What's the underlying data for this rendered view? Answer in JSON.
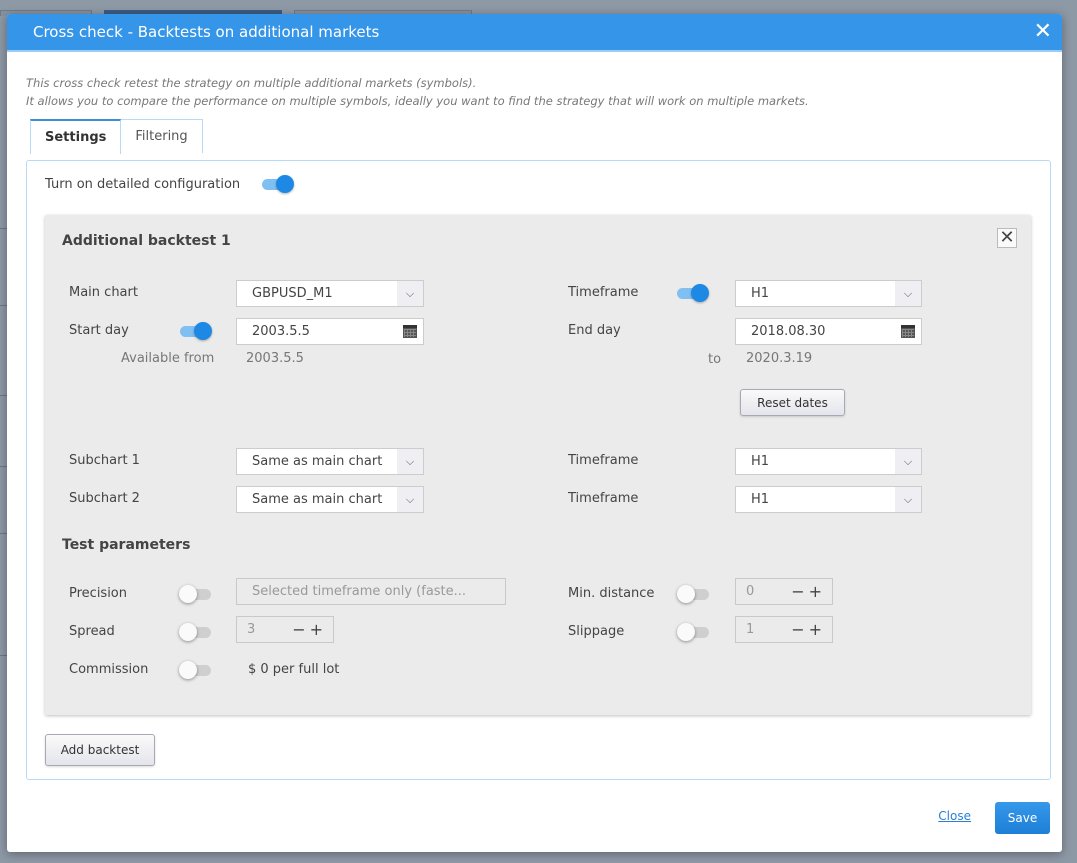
{
  "dialog": {
    "title": "Cross check - Backtests on additional markets",
    "close_icon": "close-icon",
    "description_line1": "This cross check retest the strategy on multiple additional markets (symbols).",
    "description_line2": "It allows you to compare the performance on multiple symbols, ideally you want to find the strategy that will work on multiple markets."
  },
  "tabs": [
    {
      "label": "Settings",
      "active": true
    },
    {
      "label": "Filtering",
      "active": false
    }
  ],
  "settings": {
    "detailed_config_label": "Turn on detailed configuration",
    "detailed_config_on": true
  },
  "backtest": {
    "title": "Additional backtest 1",
    "remove_icon": "close-box-icon",
    "main_chart": {
      "label": "Main chart",
      "value": "GBPUSD_M1"
    },
    "timeframe": {
      "label": "Timeframe",
      "value": "H1",
      "toggle_on": true
    },
    "start_day": {
      "label": "Start day",
      "value": "2003.5.5",
      "toggle_on": true
    },
    "end_day": {
      "label": "End day",
      "value": "2018.08.30"
    },
    "available_from_label": "Available from",
    "available_from_value": "2003.5.5",
    "available_to_label": "to",
    "available_to_value": "2020.3.19",
    "reset_dates_label": "Reset dates",
    "subchart1": {
      "label": "Subchart 1",
      "value": "Same as main chart",
      "timeframe_label": "Timeframe",
      "timeframe_value": "H1"
    },
    "subchart2": {
      "label": "Subchart 2",
      "value": "Same as main chart",
      "timeframe_label": "Timeframe",
      "timeframe_value": "H1"
    },
    "test_parameters_title": "Test parameters",
    "precision": {
      "label": "Precision",
      "value": "Selected timeframe only (faste...",
      "toggle_on": false
    },
    "spread": {
      "label": "Spread",
      "value": "3",
      "toggle_on": false
    },
    "commission": {
      "label": "Commission",
      "value": "$ 0 per full lot",
      "toggle_on": false
    },
    "min_distance": {
      "label": "Min. distance",
      "value": "0",
      "toggle_on": false
    },
    "slippage": {
      "label": "Slippage",
      "value": "1",
      "toggle_on": false
    },
    "stepper_minus": "−",
    "stepper_plus": "+"
  },
  "add_backtest_label": "Add backtest",
  "footer": {
    "close_label": "Close",
    "save_label": "Save"
  },
  "colors": {
    "titlebar": "#3595e8",
    "accent": "#1e88e5",
    "card_bg": "#ebebeb"
  }
}
